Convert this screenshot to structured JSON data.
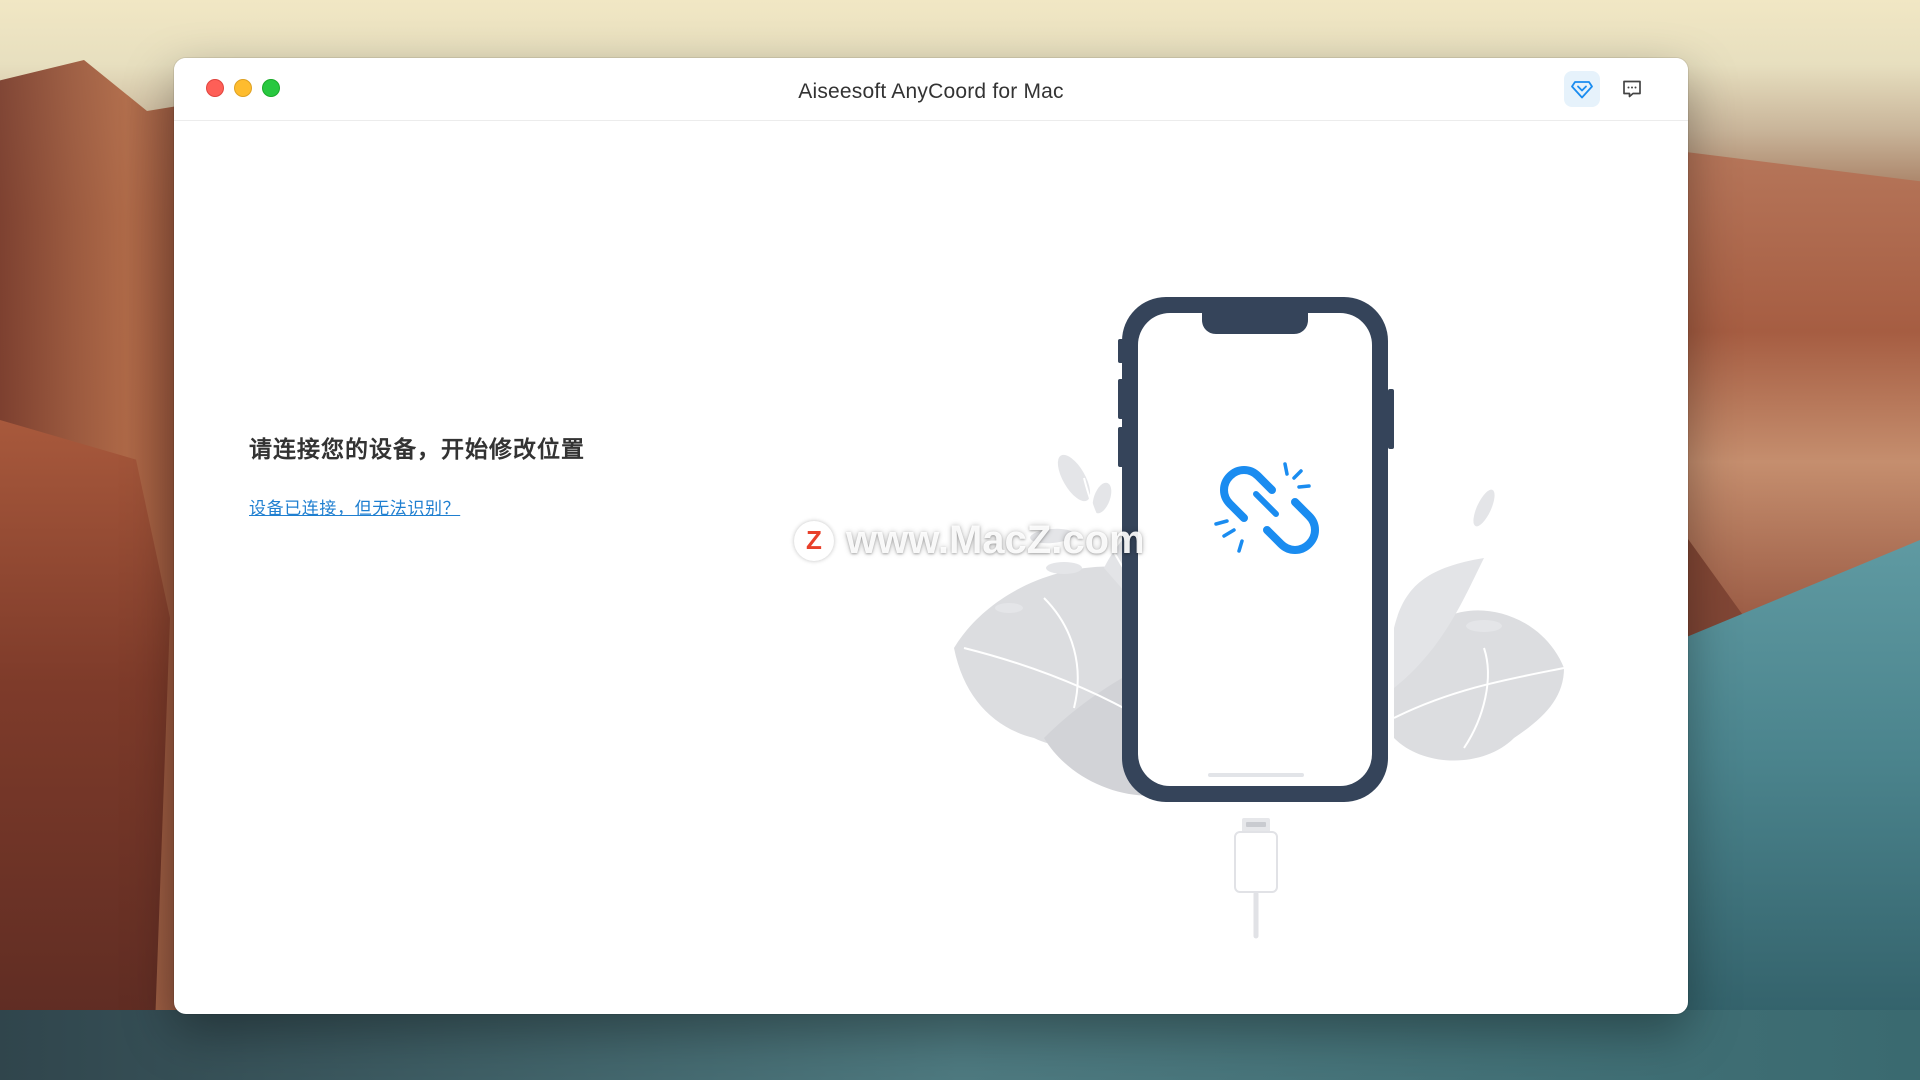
{
  "window": {
    "title": "Aiseesoft AnyCoord for Mac"
  },
  "toolbar": {
    "upgrade_icon": "diamond-icon",
    "feedback_icon": "message-icon"
  },
  "main": {
    "prompt": "请连接您的设备，开始修改位置",
    "help_link": "设备已连接，但无法识别？"
  },
  "illustration": {
    "status_icon": "broken-link-icon",
    "accent_color": "#1a8cf0",
    "phone_frame_color": "#35445a"
  },
  "watermark": {
    "logo_letter": "Z",
    "text": "www.MacZ.com"
  }
}
